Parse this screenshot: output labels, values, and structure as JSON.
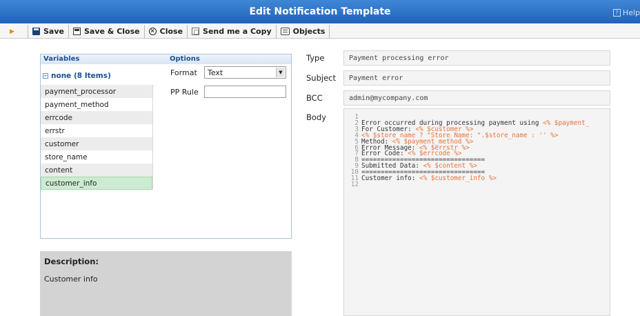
{
  "window": {
    "title": "Edit Notification Template",
    "help_label": "Help"
  },
  "toolbar": {
    "save": "Save",
    "save_close": "Save & Close",
    "close": "Close",
    "send_copy": "Send me a Copy",
    "objects": "Objects"
  },
  "variables_panel": {
    "variables_header": "Variables",
    "options_header": "Options",
    "group_label": "none (8 Items)",
    "items": [
      "payment_processor",
      "payment_method",
      "errcode",
      "errstr",
      "customer",
      "store_name",
      "content",
      "customer_info"
    ],
    "selected_index": 7,
    "format_label": "Format",
    "format_value": "Text",
    "pp_rule_label": "PP Rule",
    "pp_rule_value": ""
  },
  "description": {
    "heading": "Description:",
    "text": "Customer info"
  },
  "form": {
    "type_label": "Type",
    "type_value": "Payment processing error",
    "subject_label": "Subject",
    "subject_value": "Payment error",
    "bcc_label": "BCC",
    "bcc_value": "admin@mycompany.com",
    "body_label": "Body"
  },
  "body_lines": [
    {
      "n": "1",
      "parts": []
    },
    {
      "n": "2",
      "parts": [
        {
          "t": "Error occurred during processing payment using ",
          "c": "tx"
        },
        {
          "t": "<% $payment_",
          "c": "tg"
        }
      ]
    },
    {
      "n": "3",
      "parts": [
        {
          "t": "For Customer: ",
          "c": "tx"
        },
        {
          "t": "<% $customer %>",
          "c": "tg"
        }
      ]
    },
    {
      "n": "4",
      "parts": [
        {
          "t": "<% $store_name ? \"Store Name: \".$store_name : '' %>",
          "c": "tg"
        }
      ]
    },
    {
      "n": "5",
      "parts": [
        {
          "t": "Method: ",
          "c": "tx"
        },
        {
          "t": "<% $payment_method %>",
          "c": "tg"
        }
      ]
    },
    {
      "n": "6",
      "parts": [
        {
          "t": "Error Message: ",
          "c": "tx"
        },
        {
          "t": "<% $errstr %>",
          "c": "tg"
        }
      ]
    },
    {
      "n": "7",
      "parts": [
        {
          "t": "Error Code: ",
          "c": "tx"
        },
        {
          "t": "<% $errcode %>",
          "c": "tg"
        }
      ]
    },
    {
      "n": "8",
      "parts": [
        {
          "t": "================================",
          "c": "tx"
        }
      ]
    },
    {
      "n": "9",
      "parts": [
        {
          "t": "Submitted Data: ",
          "c": "tx"
        },
        {
          "t": "<% $content %>",
          "c": "tg"
        }
      ]
    },
    {
      "n": "10",
      "parts": [
        {
          "t": "================================",
          "c": "tx"
        }
      ]
    },
    {
      "n": "11",
      "parts": [
        {
          "t": "Customer info: ",
          "c": "tx"
        },
        {
          "t": "<% $customer_info %>",
          "c": "tg"
        }
      ]
    },
    {
      "n": "12",
      "parts": []
    }
  ],
  "colors": {
    "title_bar": "#2a70c6",
    "selected_row": "#cdebd0",
    "template_tag": "#e8733a"
  },
  "icons": [
    "save-icon",
    "save-close-icon",
    "close-icon",
    "copy-icon",
    "objects-icon",
    "help-icon",
    "collapse-icon",
    "dropdown-arrow-icon"
  ]
}
